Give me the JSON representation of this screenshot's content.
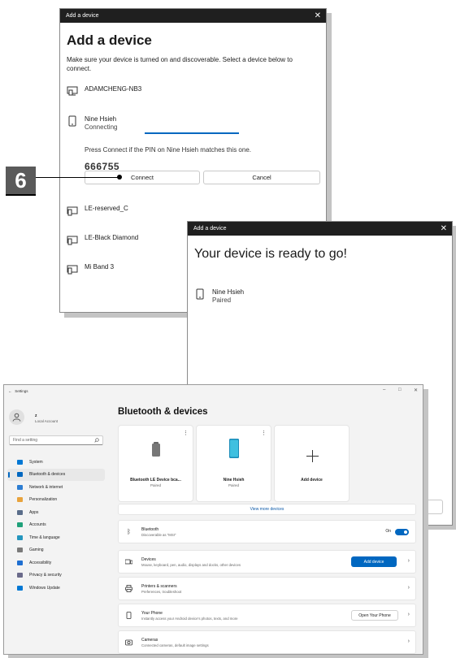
{
  "dialog_add": {
    "title_bar": "Add a device",
    "close": "✕",
    "heading": "Add a device",
    "description": "Make sure your device is turned on and discoverable. Select a device below to connect.",
    "computer": "ADAMCHENG-NB3",
    "pairing_device": {
      "name": "Nine Hsieh",
      "status": "Connecting"
    },
    "pin_prompt": "Press Connect if the PIN on Nine Hsieh matches this one.",
    "pin": "666755",
    "connect_label": "Connect",
    "cancel_label": "Cancel",
    "other_devices": [
      "LE-reserved_C",
      "LE-Black Diamond",
      "Mi Band 3"
    ]
  },
  "callout": {
    "number": "6"
  },
  "dialog_ready": {
    "title_bar": "Add a device",
    "close": "✕",
    "heading": "Your device is ready to go!",
    "device": {
      "name": "Nine Hsieh",
      "status": "Paired"
    }
  },
  "settings": {
    "app_title": "Settings",
    "back": "←",
    "window_controls": {
      "minimize": "–",
      "maximize": "□",
      "close": "✕"
    },
    "user": {
      "name": "z",
      "account": "Local Account"
    },
    "search_placeholder": "Find a setting",
    "nav": [
      {
        "label": "System",
        "color": "#0078d4"
      },
      {
        "label": "Bluetooth & devices",
        "color": "#0067c0"
      },
      {
        "label": "Network & internet",
        "color": "#2d7dd2"
      },
      {
        "label": "Personalization",
        "color": "#e8a33c"
      },
      {
        "label": "Apps",
        "color": "#5a6d8a"
      },
      {
        "label": "Accounts",
        "color": "#1fa17a"
      },
      {
        "label": "Time & language",
        "color": "#2596be"
      },
      {
        "label": "Gaming",
        "color": "#7a7a7a"
      },
      {
        "label": "Accessibility",
        "color": "#1f6fd1"
      },
      {
        "label": "Privacy & security",
        "color": "#6a6a8a"
      },
      {
        "label": "Windows Update",
        "color": "#0078d4"
      }
    ],
    "page_title": "Bluetooth & devices",
    "cards": [
      {
        "name": "Bluetooth LE Device bca...",
        "status": "Paired"
      },
      {
        "name": "Nine Hsieh",
        "status": "Paired"
      },
      {
        "name": "Add device"
      }
    ],
    "view_more": "View more devices",
    "bluetooth": {
      "title": "Bluetooth",
      "sub": "Discoverable as \"MSI\"",
      "state": "On"
    },
    "devices": {
      "title": "Devices",
      "sub": "Mouse, keyboard, pen, audio, displays and docks, other devices",
      "button": "Add device"
    },
    "printers": {
      "title": "Printers & scanners",
      "sub": "Preferences, troubleshoot"
    },
    "phone": {
      "title": "Your Phone",
      "sub": "Instantly access your Android device's photos, texts, and more",
      "button": "Open Your Phone"
    },
    "cameras": {
      "title": "Cameras",
      "sub": "Connected cameras, default image settings"
    }
  }
}
